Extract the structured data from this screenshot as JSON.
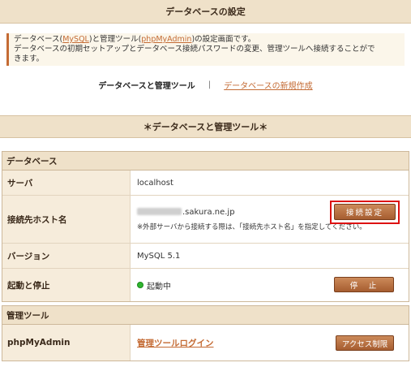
{
  "page": {
    "title": "データベースの設定"
  },
  "description": {
    "line1_prefix": "データベース(",
    "mysql_link": "MySQL",
    "line1_mid": ")と管理ツール(",
    "phpmyadmin_link": "phpMyAdmin",
    "line1_suffix": ")の設定画面です。",
    "line2": "データベースの初期セットアップとデータベース接続パスワードの変更、管理ツールへ接続することがで",
    "line3": "きます。"
  },
  "subnav": {
    "current": "データベースと管理ツール",
    "separator": "|",
    "new_link": "データベースの新規作成"
  },
  "section": {
    "title": "＊データベースと管理ツール＊"
  },
  "database_panel": {
    "header": "データベース",
    "server_label": "サーバ",
    "server_value": "localhost",
    "host_label": "接続先ホスト名",
    "host_value_suffix": ".sakura.ne.jp",
    "host_note": "※外部サーバから接続する際は、「接続先ホスト名」を指定してください。",
    "connect_settings_button": "接続設定",
    "version_label": "バージョン",
    "version_value": "MySQL 5.1",
    "status_label": "起動と停止",
    "status_value": "起動中",
    "stop_button": "停　止"
  },
  "tools_panel": {
    "header": "管理ツール",
    "phpmyadmin_label": "phpMyAdmin",
    "login_link": "管理ツールログイン",
    "access_limit_button": "アクセス制限"
  },
  "colors": {
    "accent": "#c46b34",
    "header_bg": "#efe1c9",
    "label_bg": "#f6ecdb",
    "button_bg": "#b36a3d",
    "highlight": "#dd1111",
    "running": "#2fb52f"
  }
}
